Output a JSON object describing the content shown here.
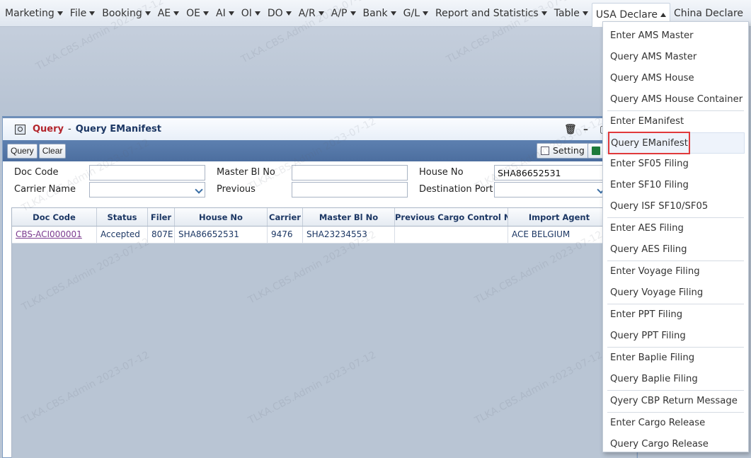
{
  "menubar": {
    "items": [
      {
        "label": "Marketing"
      },
      {
        "label": "File"
      },
      {
        "label": "Booking"
      },
      {
        "label": "AE"
      },
      {
        "label": "OE"
      },
      {
        "label": "AI"
      },
      {
        "label": "OI"
      },
      {
        "label": "DO"
      },
      {
        "label": "A/R"
      },
      {
        "label": "A/P"
      },
      {
        "label": "Bank"
      },
      {
        "label": "G/L"
      },
      {
        "label": "Report and Statistics"
      },
      {
        "label": "Table"
      },
      {
        "label": "USA Declare"
      },
      {
        "label": "China Declare"
      }
    ]
  },
  "dropdown": {
    "items": [
      "Enter AMS Master",
      "Query AMS Master",
      "Query AMS House",
      "Query AMS House Container",
      "Enter EManifest",
      "Query EManifest",
      "Enter SF05 Filing",
      "Enter SF10 Filing",
      "Query ISF SF10/SF05",
      "Enter AES Filing",
      "Query AES Filing",
      "Enter Voyage Filing",
      "Query Voyage Filing",
      "Enter PPT Filing",
      "Query PPT Filing",
      "Enter Baplie Filing",
      "Query Baplie Filing",
      "Qyery CBP Return Message",
      "Enter Cargo Release",
      "Query Cargo Release"
    ],
    "highlight_color": "#e0393b"
  },
  "window": {
    "title_prefix": "Query",
    "title_sep": "-",
    "title": "Query EManifest",
    "toolbar": {
      "query": "Query",
      "clear": "Clear",
      "setting": "Setting"
    }
  },
  "form": {
    "doc_code_label": "Doc Code",
    "doc_code_value": "",
    "master_bl_label": "Master Bl No",
    "master_bl_value": "",
    "house_no_label": "House No",
    "house_no_value": "SHA86652531",
    "carrier_name_label": "Carrier Name",
    "carrier_name_value": "",
    "previous_label": "Previous",
    "previous_value": "",
    "destination_port_label": "Destination Port",
    "destination_port_value": ""
  },
  "grid": {
    "headers": [
      "Doc Code",
      "Status",
      "Filer",
      "House No",
      "Carrier",
      "Master Bl No",
      "Previous Cargo Control No",
      "Import Agent"
    ],
    "rows": [
      [
        "CBS-ACI000001",
        "Accepted",
        "807E",
        "SHA86652531",
        "9476",
        "SHA23234553",
        "",
        "ACE BELGIUM"
      ]
    ]
  },
  "watermark": "TLKA.CBS.Admin 2023-07-12"
}
